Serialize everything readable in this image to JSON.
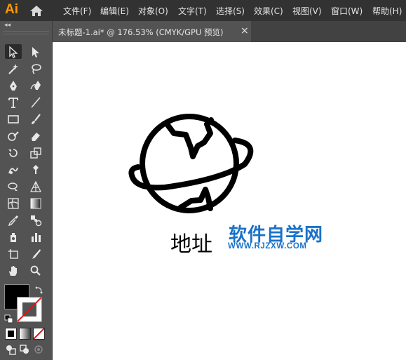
{
  "app": {
    "logo_text": "Ai"
  },
  "menu": [
    "文件(F)",
    "编辑(E)",
    "对象(O)",
    "文字(T)",
    "选择(S)",
    "效果(C)",
    "视图(V)",
    "窗口(W)",
    "帮助(H)"
  ],
  "toolbar": {
    "collapse_label": "◂◂"
  },
  "document_tab": {
    "title": "未标题-1.ai* @ 176.53% (CMYK/GPU 预览)",
    "close_label": "×"
  },
  "artwork": {
    "address_text": "地址"
  },
  "watermark": {
    "name": "软件自学网",
    "url": "WWW.RJZXW.COM",
    "color": "#1a72c9"
  },
  "colors": {
    "fill": "#000000",
    "stroke": "none"
  }
}
